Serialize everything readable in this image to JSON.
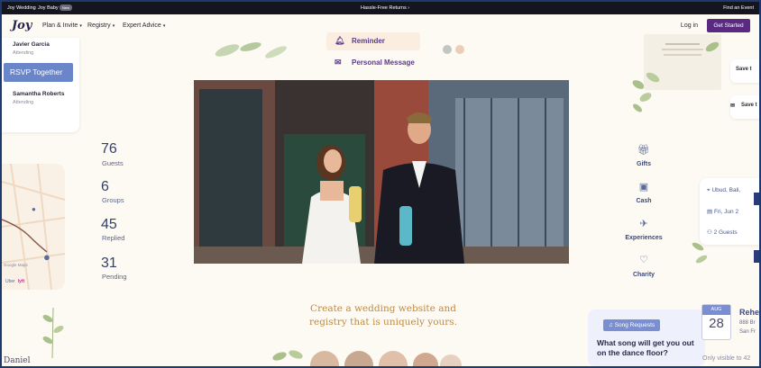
{
  "topbar": {
    "joy_wedding": "Joy Wedding",
    "joy_baby": "Joy Baby",
    "baby_badge": "New",
    "promo": "Hassle-Free Returns",
    "promo_chevron": "›",
    "find_event": "Find an Event"
  },
  "navbar": {
    "logo": "Joy",
    "items": [
      {
        "label": "Plan & Invite",
        "chevron": "▾"
      },
      {
        "label": "Registry",
        "chevron": "▾"
      },
      {
        "label": "Expert Advice",
        "chevron": "▾"
      }
    ],
    "login": "Log in",
    "get_started": "Get Started"
  },
  "attendees": [
    {
      "name": "Javier Garcia",
      "status": "Attending"
    },
    {
      "name": "Samantha Roberts",
      "status": "Attending"
    }
  ],
  "rsvp_button": "RSVP Together",
  "stats": [
    {
      "value": "76",
      "label": "Guests"
    },
    {
      "value": "6",
      "label": "Groups"
    },
    {
      "value": "45",
      "label": "Replied"
    },
    {
      "value": "31",
      "label": "Pending"
    }
  ],
  "map": {
    "google": "Google Maps",
    "uber": "Uber",
    "lyft": "lyft"
  },
  "message_options": [
    {
      "icon": "bell-icon",
      "label": "Reminder"
    },
    {
      "icon": "envelope-icon",
      "label": "Personal Message"
    }
  ],
  "registry_options": [
    {
      "icon": "gift-icon",
      "label": "Gifts"
    },
    {
      "icon": "wallet-icon",
      "label": "Cash"
    },
    {
      "icon": "airplane-icon",
      "label": "Experiences"
    },
    {
      "icon": "heart-icon",
      "label": "Charity"
    }
  ],
  "trip": {
    "location": "Ubud, Bali,",
    "date": "Fri, Jun 2",
    "guests": "2 Guests"
  },
  "save_cards": [
    "Save t",
    "Save t"
  ],
  "tagline": {
    "line1": "Create a wedding website and",
    "line2": "registry that is uniquely yours."
  },
  "song": {
    "badge": "Song Requests",
    "question": "What song will get you out on the dance floor?"
  },
  "visibility": "Only visible to 42",
  "calendar": {
    "month": "AUG",
    "day": "28"
  },
  "rehearsal": {
    "title": "Rehea",
    "line1": "888 Br",
    "line2": "San Fr"
  },
  "daniel": "Daniel",
  "colors": {
    "accent_purple": "#5a2a82",
    "rsvp_blue": "#6a86c8",
    "tagline_gold": "#c08a3e",
    "frame_blue": "#1d3a6e"
  }
}
